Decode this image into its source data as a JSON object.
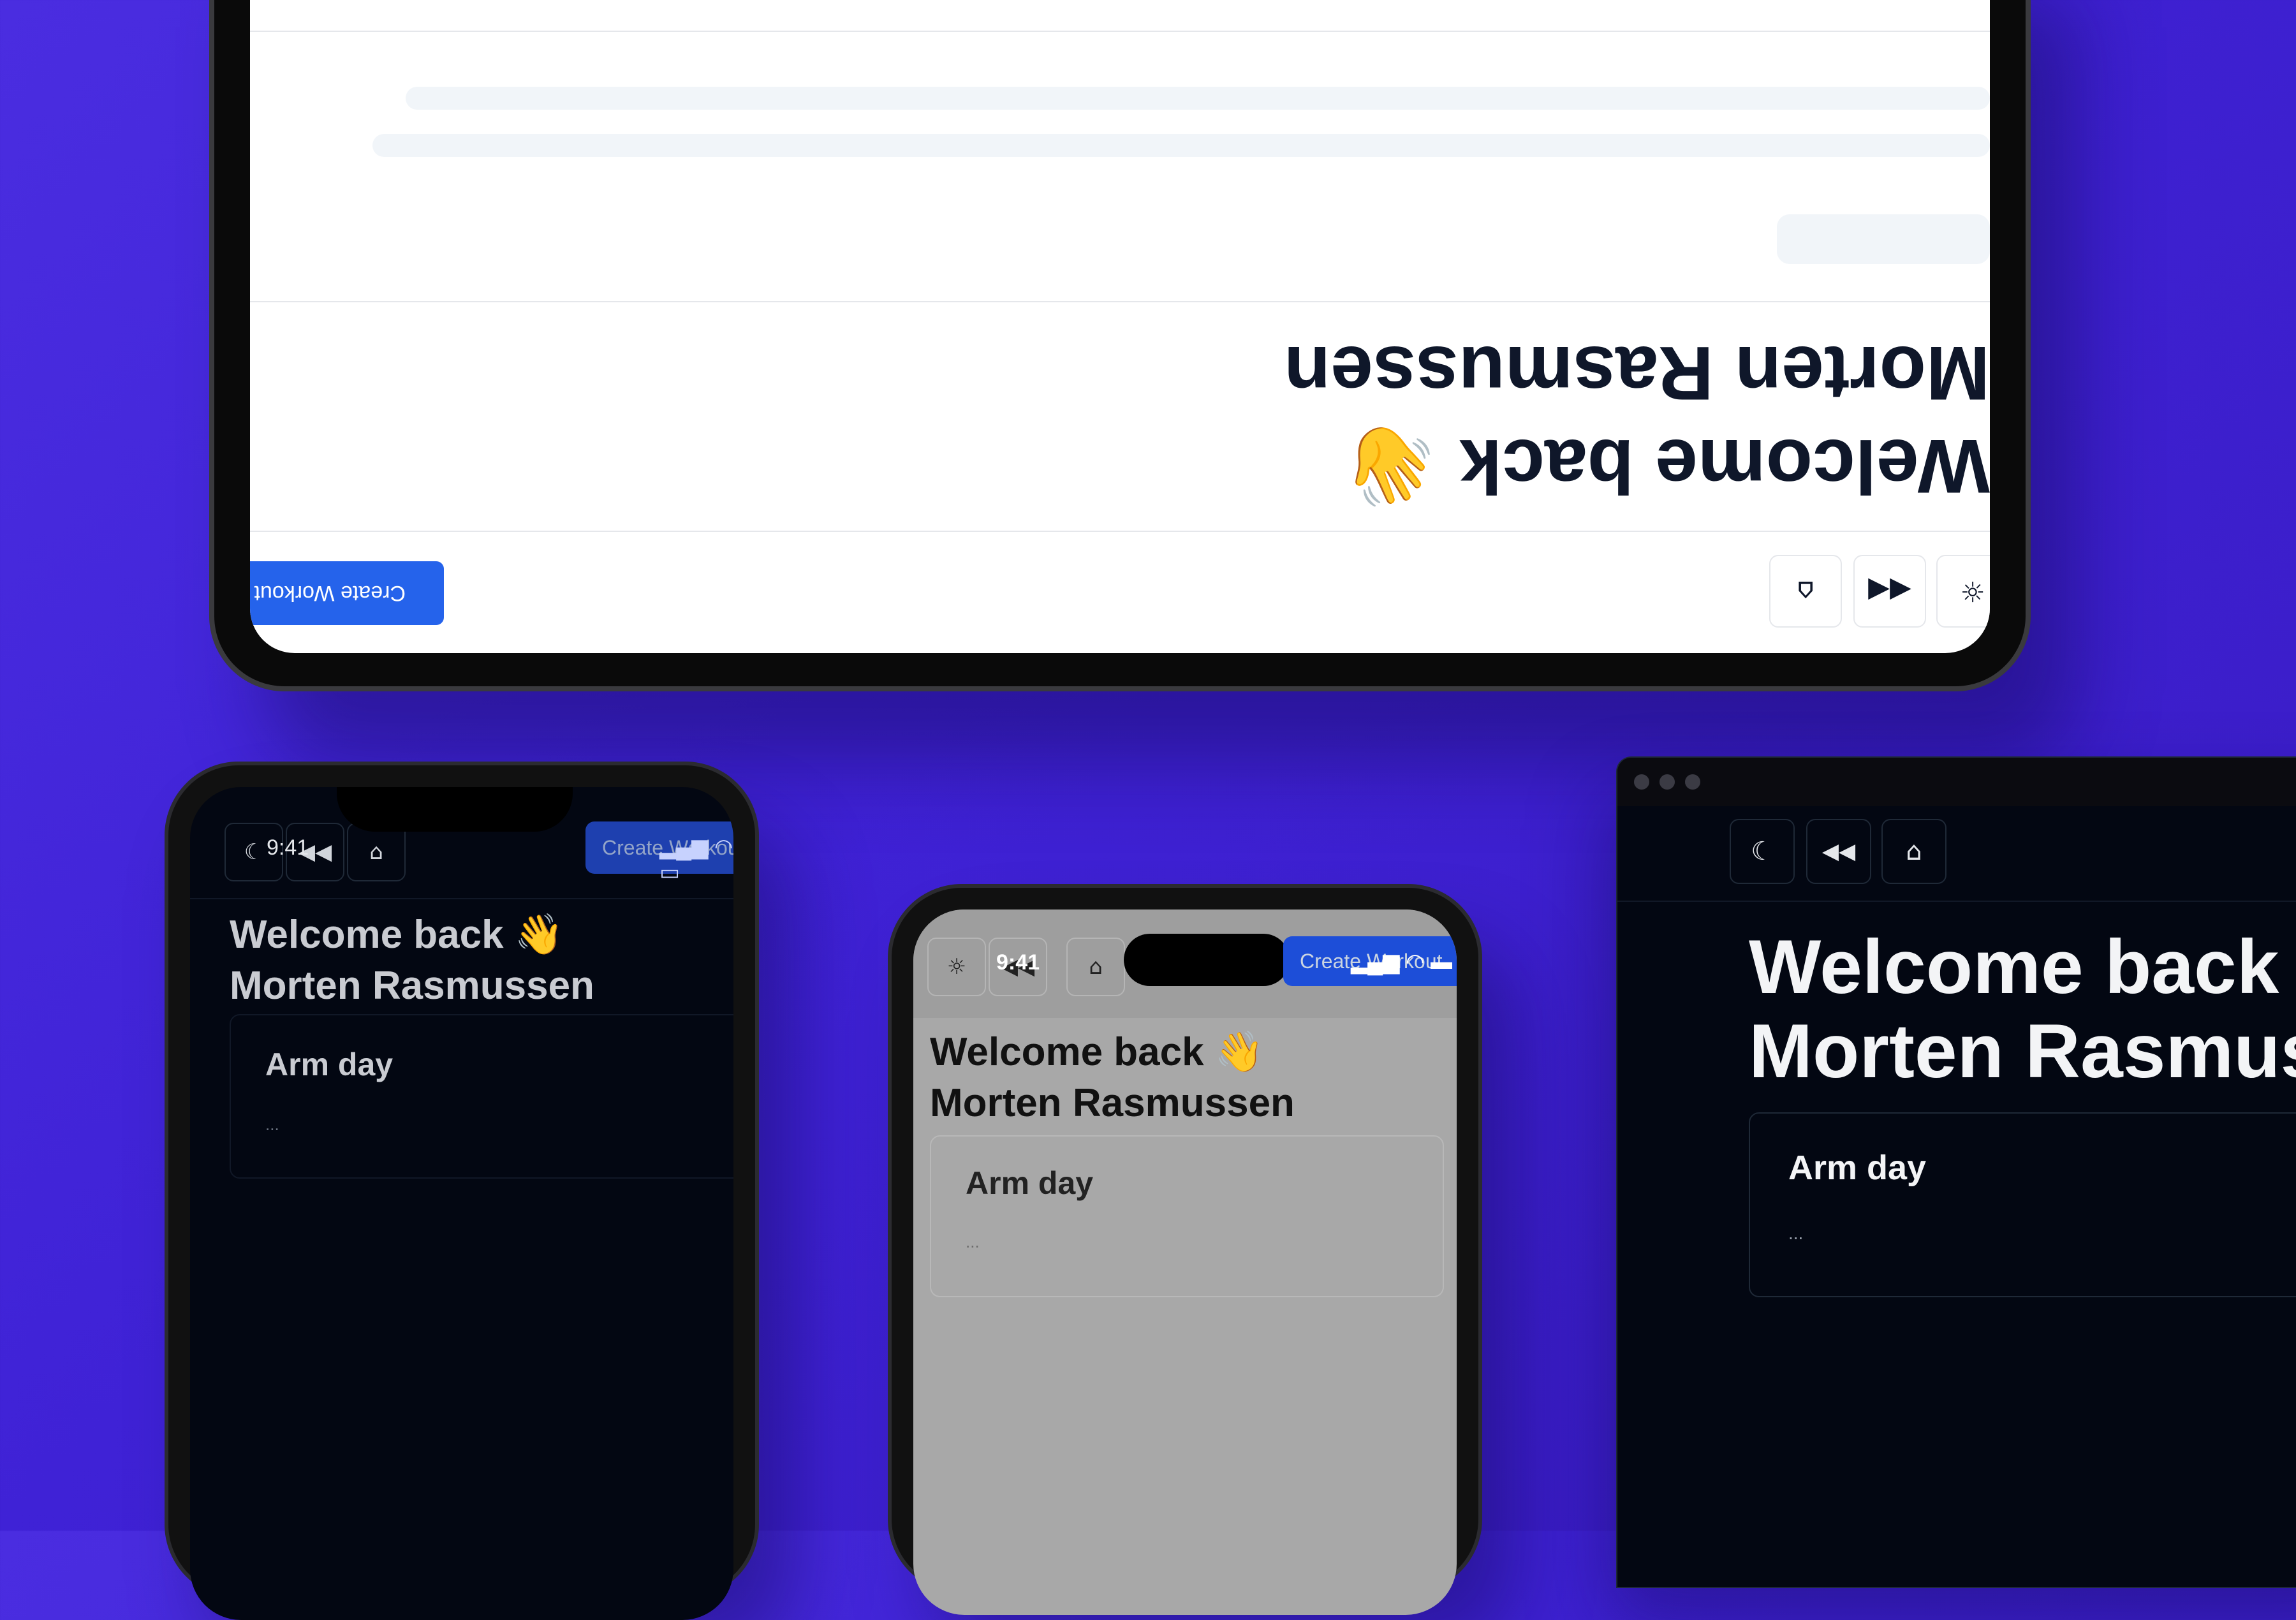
{
  "tablet": {
    "create_button": "Create Workout",
    "welcome_line1": "Welcome back 👋",
    "welcome_line2": "Morten Rasmussen",
    "icons": [
      "sun-icon",
      "fast-forward-icon",
      "home-icon"
    ]
  },
  "phone_dark": {
    "time": "9:41",
    "create_button": "Create Workout",
    "welcome_line1": "Welcome back 👋",
    "welcome_line2": "Morten Rasmussen",
    "card_title": "Arm day",
    "card_dots": "...",
    "icons": [
      "moon-icon",
      "rewind-icon",
      "home-icon"
    ]
  },
  "phone_light": {
    "time": "9:41",
    "create_button": "Create Workout",
    "welcome_line1": "Welcome back 👋",
    "welcome_line2": "Morten Rasmussen",
    "card_title": "Arm day",
    "card_dots": "...",
    "icons": [
      "sun-icon",
      "rewind-icon",
      "home-icon"
    ]
  },
  "desktop": {
    "welcome_line1": "Welcome back",
    "welcome_line2": "Morten Rasmussen",
    "card_title": "Arm day",
    "card_dots": "...",
    "icons": [
      "moon-icon",
      "rewind-icon",
      "home-icon"
    ]
  },
  "colors": {
    "background": "#3f22d6",
    "accent": "#2563eb",
    "dark_surface": "#030712",
    "light_text": "#0f172a"
  }
}
